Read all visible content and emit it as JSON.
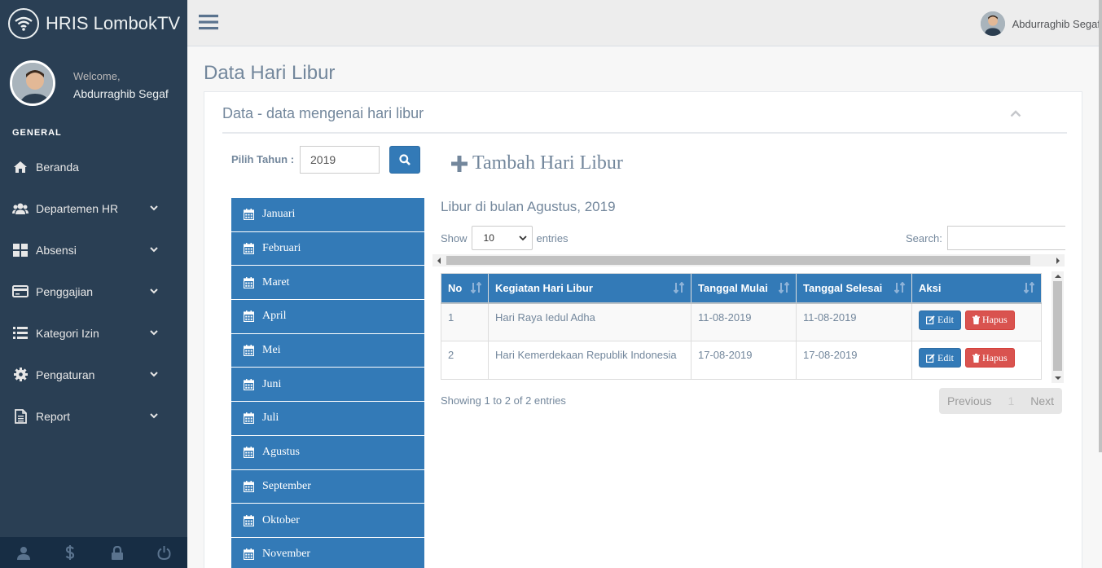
{
  "app": {
    "title": "HRIS LombokTV"
  },
  "profile": {
    "welcome": "Welcome,",
    "name": "Abdurraghib Segaf"
  },
  "sidebar": {
    "section_title": "GENERAL",
    "items": [
      {
        "label": "Beranda",
        "icon": "home-icon",
        "has_children": false
      },
      {
        "label": "Departemen HR",
        "icon": "users-icon",
        "has_children": true
      },
      {
        "label": "Absensi",
        "icon": "grid-icon",
        "has_children": true
      },
      {
        "label": "Penggajian",
        "icon": "credit-card-icon",
        "has_children": true
      },
      {
        "label": "Kategori Izin",
        "icon": "list-icon",
        "has_children": true
      },
      {
        "label": "Pengaturan",
        "icon": "gear-icon",
        "has_children": true
      },
      {
        "label": "Report",
        "icon": "document-icon",
        "has_children": true
      }
    ],
    "footer_icons": [
      "user-icon",
      "dollar-icon",
      "lock-icon",
      "power-icon"
    ]
  },
  "topnav": {
    "user_name": "Abdurraghib Segaf"
  },
  "page": {
    "title": "Data Hari Libur",
    "panel_title": "Data - data mengenai hari libur",
    "year_label": "Pilih Tahun :",
    "year_value": "2019",
    "add_button": "Tambah Hari Libur",
    "month_heading": "Libur di bulan Agustus, 2019",
    "months": [
      "Januari",
      "Februari",
      "Maret",
      "April",
      "Mei",
      "Juni",
      "Juli",
      "Agustus",
      "September",
      "Oktober",
      "November"
    ]
  },
  "table": {
    "show_label": "Show",
    "entries_label": "entries",
    "page_length": "10",
    "search_label": "Search:",
    "columns": [
      "No",
      "Kegiatan Hari Libur",
      "Tanggal Mulai",
      "Tanggal Selesai",
      "Aksi"
    ],
    "rows": [
      {
        "no": "1",
        "kegiatan": "Hari Raya Iedul Adha",
        "mulai": "11-08-2019",
        "selesai": "11-08-2019"
      },
      {
        "no": "2",
        "kegiatan": "Hari Kemerdekaan Republik Indonesia",
        "mulai": "17-08-2019",
        "selesai": "17-08-2019"
      }
    ],
    "edit_label": "Edit",
    "delete_label": "Hapus",
    "info": "Showing 1 to 2 of 2 entries",
    "prev_label": "Previous",
    "current_page": "1",
    "next_label": "Next"
  },
  "colors": {
    "sidebar": "#2a3f54",
    "primary": "#337ab7",
    "danger": "#d9534f",
    "text": "#73879c"
  }
}
